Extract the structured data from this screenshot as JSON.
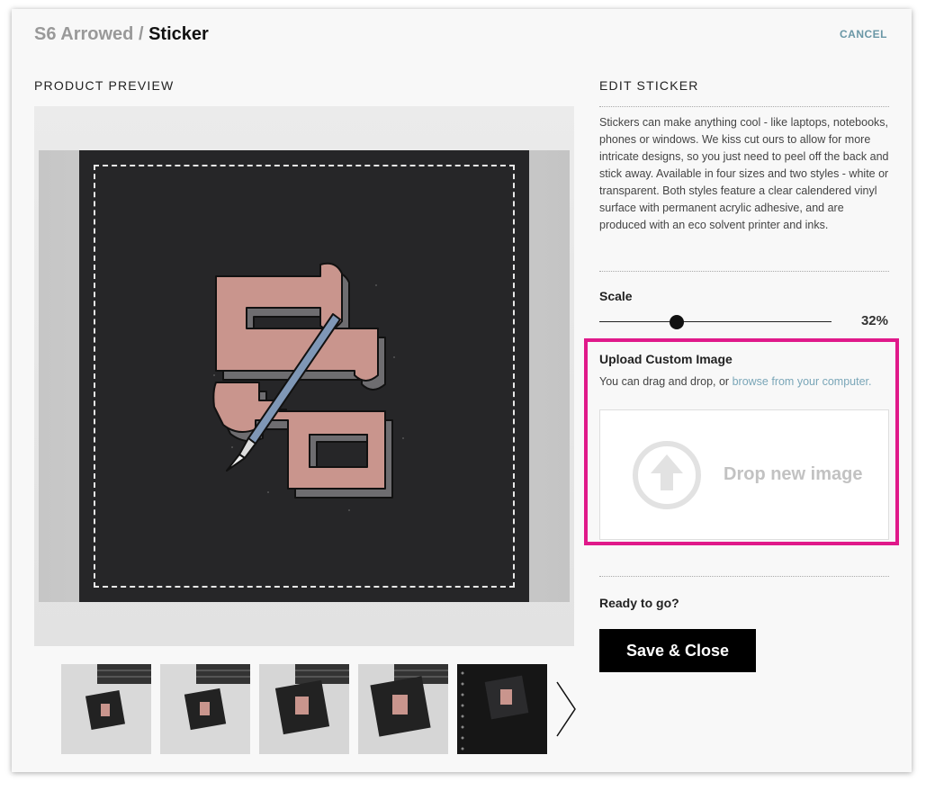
{
  "header": {
    "breadcrumb_parent": "S6 Arrowed /",
    "breadcrumb_current": "Sticker",
    "cancel_label": "CANCEL"
  },
  "preview": {
    "label": "PRODUCT PREVIEW",
    "thumbnails": [
      "laptop-thumb-1",
      "laptop-thumb-2",
      "laptop-thumb-3",
      "laptop-thumb-4",
      "notebook-thumb"
    ],
    "next_icon": "chevron-right-icon"
  },
  "edit": {
    "label": "EDIT STICKER",
    "description": "Stickers can make anything cool - like laptops, notebooks, phones or windows. We kiss cut ours to allow for more intricate designs, so you just need to peel off the back and stick away. Available in four sizes and two styles - white or transparent. Both styles feature a clear calendered vinyl surface with permanent acrylic adhesive, and are produced with an eco solvent printer and inks.",
    "scale": {
      "label": "Scale",
      "value_label": "32%",
      "value": 0.32
    },
    "upload": {
      "title": "Upload Custom Image",
      "hint_prefix": "You can drag and drop, or ",
      "hint_link": "browse from your computer.",
      "drop_label": "Drop new image",
      "icon": "upload-arrow-icon",
      "highlight_color": "#e0198a"
    },
    "ready_label": "Ready to go?",
    "save_label": "Save & Close"
  },
  "colors": {
    "accent_link": "#6a97a6",
    "sticker_bg": "#262628",
    "letter_fill": "#c9958d",
    "pen_blue": "#7f97b6"
  }
}
